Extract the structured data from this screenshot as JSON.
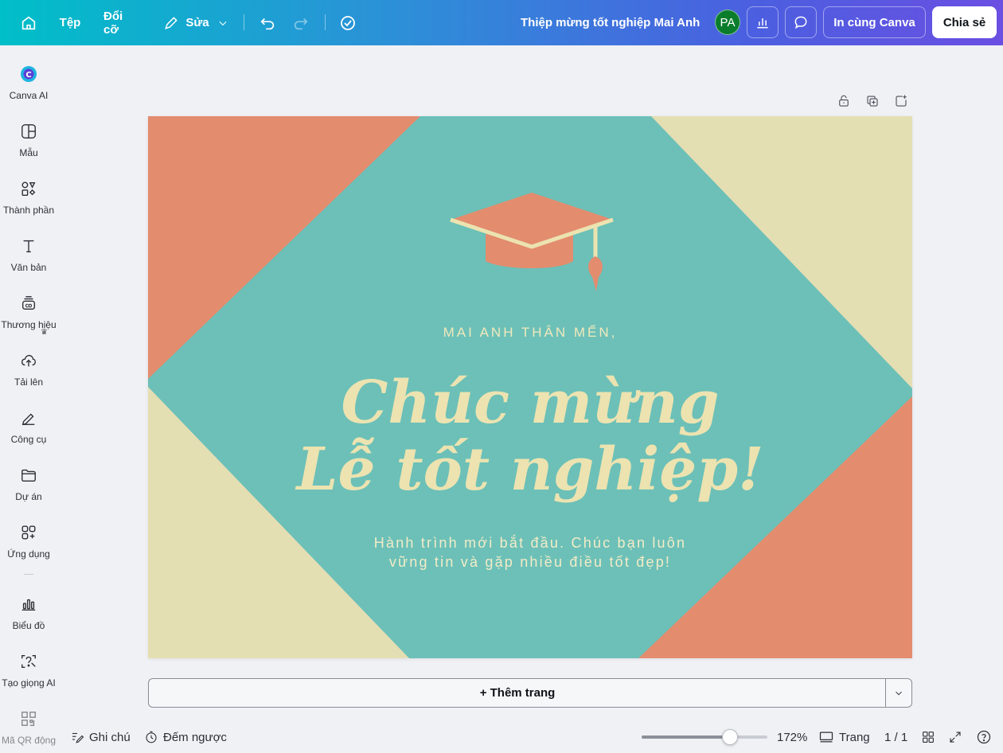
{
  "topbar": {
    "home_icon": "home-icon",
    "file_label": "Tệp",
    "resize_label": "Đổi cỡ",
    "edit_label": "Sửa",
    "doc_title": "Thiệp mừng tốt nghiệp Mai Anh",
    "avatar_initials": "PA",
    "avatar_color": "#0a7d2c",
    "print_label": "In cùng Canva",
    "share_label": "Chia sẻ",
    "gradient": [
      "#00bfc8",
      "#4b5fe0",
      "#6a4fe2"
    ]
  },
  "sidebar": {
    "items": [
      {
        "label": "Canva AI",
        "icon": "canva-ai-icon"
      },
      {
        "label": "Mẫu",
        "icon": "templates-icon"
      },
      {
        "label": "Thành phần",
        "icon": "elements-icon"
      },
      {
        "label": "Văn bản",
        "icon": "text-icon"
      },
      {
        "label": "Thương hiệu",
        "icon": "brand-icon"
      },
      {
        "label": "Tải lên",
        "icon": "upload-icon"
      },
      {
        "label": "Công cụ",
        "icon": "tools-icon"
      },
      {
        "label": "Dự án",
        "icon": "folder-icon"
      },
      {
        "label": "Ứng dụng",
        "icon": "apps-icon"
      },
      {
        "label": "Biểu đồ",
        "icon": "chart-icon"
      },
      {
        "label": "Tạo giọng AI",
        "icon": "ai-voice-icon"
      },
      {
        "label": "Mã QR động",
        "icon": "qr-code-icon"
      }
    ]
  },
  "design": {
    "greeting": "MAI ANH THÂN MẾN,",
    "headline_line1": "Chúc mừng",
    "headline_line2": "Lễ tốt nghiệp!",
    "subtext": "Hành trình mới bắt đầu. Chúc bạn luôn vững tin và gặp nhiều điều tốt đẹp!",
    "colors": {
      "teal": "#6cc0b8",
      "coral": "#e38c6e",
      "cream": "#e4deb3",
      "text": "#ece3b0"
    }
  },
  "add_page_label": "+ Thêm trang",
  "bottombar": {
    "notes_label": "Ghi chú",
    "timer_label": "Đếm ngược",
    "zoom_label": "172%",
    "zoom_fraction": 0.7,
    "pages_label": "Trang",
    "page_count": "1 / 1",
    "help_label": "?"
  }
}
